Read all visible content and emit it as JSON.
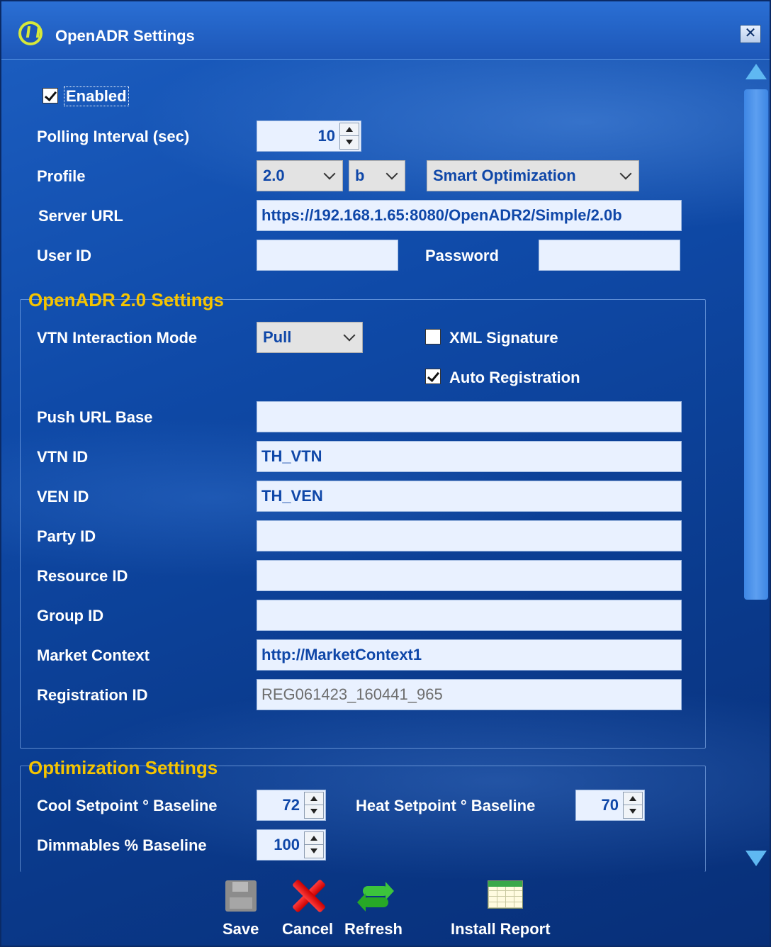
{
  "window": {
    "title": "OpenADR Settings"
  },
  "general": {
    "enabled_label": "Enabled",
    "polling_label": "Polling Interval (sec)",
    "polling_value": "10",
    "profile_label": "Profile",
    "profile_version": "2.0",
    "profile_variant": "b",
    "profile_mode": "Smart Optimization",
    "server_url_label": "Server URL",
    "server_url_value": "https://192.168.1.65:8080/OpenADR2/Simple/2.0b",
    "user_id_label": "User ID",
    "user_id_value": "",
    "password_label": "Password",
    "password_value": ""
  },
  "openadr20": {
    "section_title": "OpenADR 2.0 Settings",
    "vtn_mode_label": "VTN Interaction Mode",
    "vtn_mode_value": "Pull",
    "xml_signature_label": "XML Signature",
    "auto_registration_label": "Auto Registration",
    "push_url_label": "Push URL Base",
    "push_url_value": "",
    "vtn_id_label": "VTN ID",
    "vtn_id_value": "TH_VTN",
    "ven_id_label": "VEN ID",
    "ven_id_value": "TH_VEN",
    "party_id_label": "Party ID",
    "party_id_value": "",
    "resource_id_label": "Resource ID",
    "resource_id_value": "",
    "group_id_label": "Group ID",
    "group_id_value": "",
    "market_context_label": "Market Context",
    "market_context_value": "http://MarketContext1",
    "registration_id_label": "Registration ID",
    "registration_id_value": "REG061423_160441_965"
  },
  "optimization": {
    "section_title": "Optimization Settings",
    "cool_label": "Cool Setpoint ° Baseline",
    "cool_value": "72",
    "heat_label": "Heat Setpoint ° Baseline",
    "heat_value": "70",
    "dimmables_label": "Dimmables % Baseline",
    "dimmables_value": "100"
  },
  "toolbar": {
    "save_label": "Save",
    "cancel_label": "Cancel",
    "refresh_label": "Refresh",
    "install_report_label": "Install Report"
  },
  "state": {
    "enabled": true,
    "xml_signature": false,
    "auto_registration": true
  },
  "icons": [
    "openadr-logo-icon",
    "close-icon",
    "scroll-up-icon",
    "scroll-down-icon",
    "save-icon",
    "cancel-icon",
    "refresh-icon",
    "install-report-icon"
  ],
  "colors": {
    "section_title": "#f5c400",
    "field_text": "#0f47a8",
    "background": "#0f4aa8"
  }
}
